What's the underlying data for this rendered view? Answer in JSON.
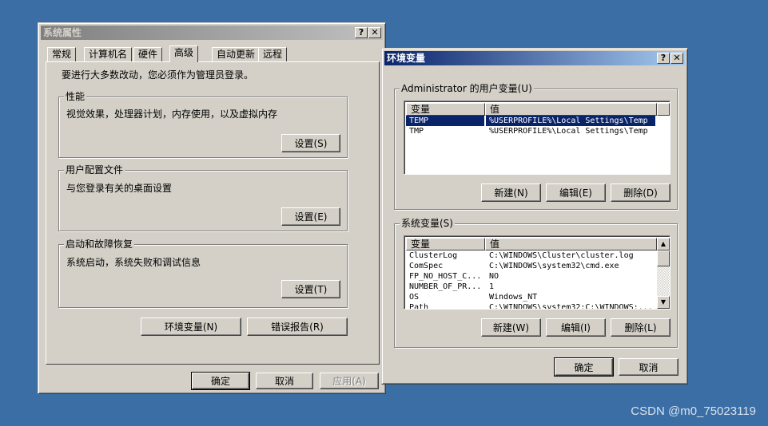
{
  "sysprop": {
    "title": "系统属性",
    "help_btn": "?",
    "close_btn": "✕",
    "tabs": [
      "常规",
      "计算机名",
      "硬件",
      "高级",
      "自动更新",
      "远程"
    ],
    "admin_notice": "要进行大多数改动，您必须作为管理员登录。",
    "perf": {
      "label": "性能",
      "desc": "视觉效果，处理器计划，内存使用，以及虚拟内存",
      "btn": "设置(S)"
    },
    "profile": {
      "label": "用户配置文件",
      "desc": "与您登录有关的桌面设置",
      "btn": "设置(E)"
    },
    "startup": {
      "label": "启动和故障恢复",
      "desc": "系统启动，系统失败和调试信息",
      "btn": "设置(T)"
    },
    "env_btn": "环境变量(N)",
    "err_btn": "错误报告(R)",
    "ok": "确定",
    "cancel": "取消",
    "apply": "应用(A)"
  },
  "envvars": {
    "title": "环境变量",
    "help_btn": "?",
    "close_btn": "✕",
    "user_group": "Administrator 的用户变量(U)",
    "col_var": "变量",
    "col_val": "值",
    "user_rows": [
      {
        "name": "TEMP",
        "value": "%USERPROFILE%\\Local Settings\\Temp"
      },
      {
        "name": "TMP",
        "value": "%USERPROFILE%\\Local Settings\\Temp"
      }
    ],
    "user_new": "新建(N)",
    "user_edit": "编辑(E)",
    "user_delete": "删除(D)",
    "sys_group": "系统变量(S)",
    "sys_rows": [
      {
        "name": "ClusterLog",
        "value": "C:\\WINDOWS\\Cluster\\cluster.log"
      },
      {
        "name": "ComSpec",
        "value": "C:\\WINDOWS\\system32\\cmd.exe"
      },
      {
        "name": "FP_NO_HOST_C...",
        "value": "NO"
      },
      {
        "name": "NUMBER_OF_PR...",
        "value": "1"
      },
      {
        "name": "OS",
        "value": "Windows_NT"
      },
      {
        "name": "Path",
        "value": "C:\\WINDOWS\\system32;C:\\WINDOWS;..."
      }
    ],
    "sys_new": "新建(W)",
    "sys_edit": "编辑(I)",
    "sys_delete": "删除(L)",
    "ok": "确定",
    "cancel": "取消"
  },
  "watermark": "CSDN @m0_75023119"
}
